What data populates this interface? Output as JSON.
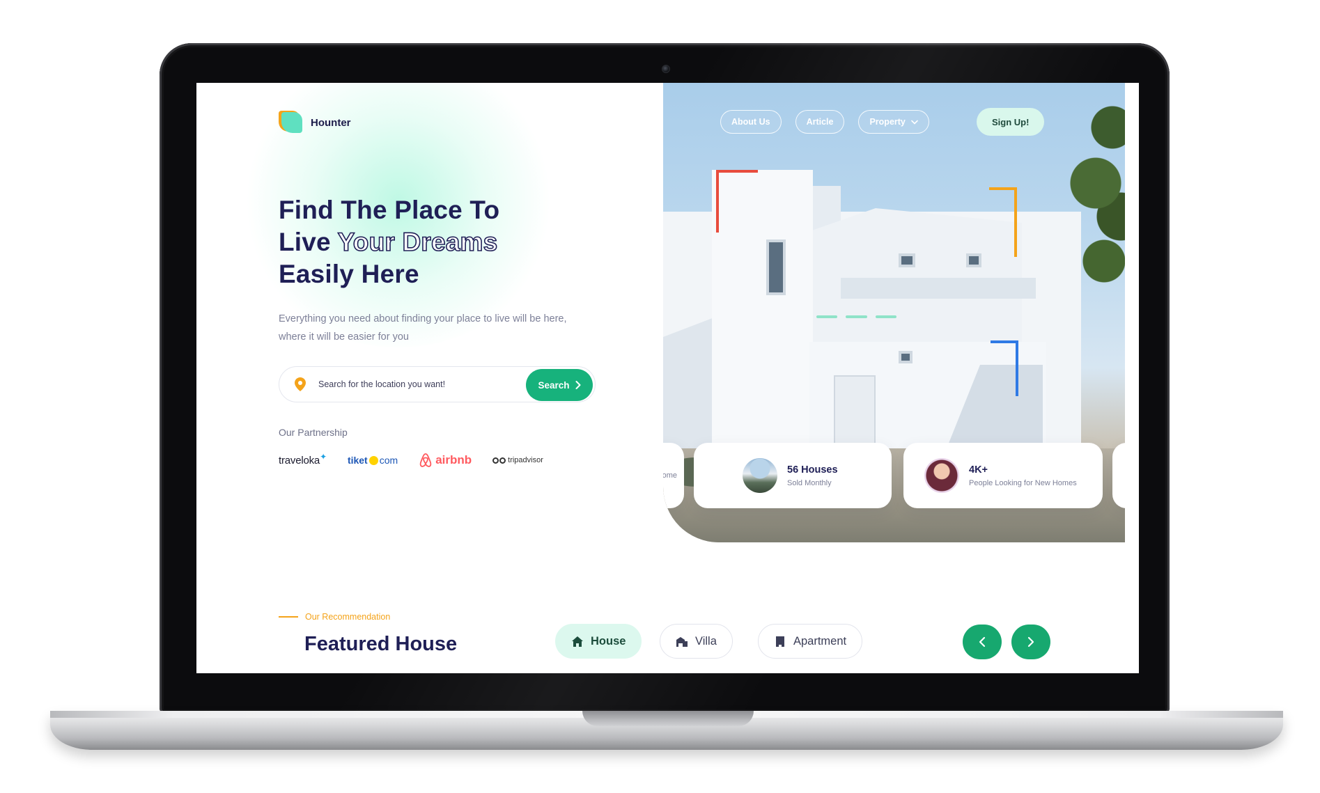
{
  "brand": {
    "name": "Hounter",
    "accent_green": "#17b27c",
    "accent_orange": "#f4a31a",
    "heading_color": "#1f1f56"
  },
  "nav": {
    "items": [
      {
        "label": "About Us"
      },
      {
        "label": "Article"
      },
      {
        "label": "Property",
        "icon": "chevron-down-icon"
      }
    ],
    "signup_label": "Sign Up!"
  },
  "hero": {
    "headline_line1": "Find The Place To",
    "headline_live": "Live",
    "headline_outline": "Your Dreams",
    "headline_line3": "Easily Here",
    "subtitle": "Everything you need about finding your place to live will be here, where it will be easier for you"
  },
  "search": {
    "placeholder": "Search for the location you want!",
    "button_label": "Search",
    "icon": "location-pin-icon"
  },
  "partnership": {
    "label": "Our Partnership",
    "partners": [
      "traveloka",
      "tiket",
      "com",
      "airbnb",
      "tripadvisor"
    ]
  },
  "stats": {
    "ghost_left_text": "ome",
    "card1": {
      "title": "56 Houses",
      "subtitle": "Sold Monthly"
    },
    "card2": {
      "title": "4K+",
      "subtitle": "People Looking for New Homes"
    }
  },
  "recommendation": {
    "eyebrow": "Our Recommendation",
    "title": "Featured House",
    "categories": [
      {
        "label": "House",
        "icon": "home-icon",
        "active": true
      },
      {
        "label": "Villa",
        "icon": "villa-icon",
        "active": false
      },
      {
        "label": "Apartment",
        "icon": "apartment-icon",
        "active": false
      }
    ]
  }
}
